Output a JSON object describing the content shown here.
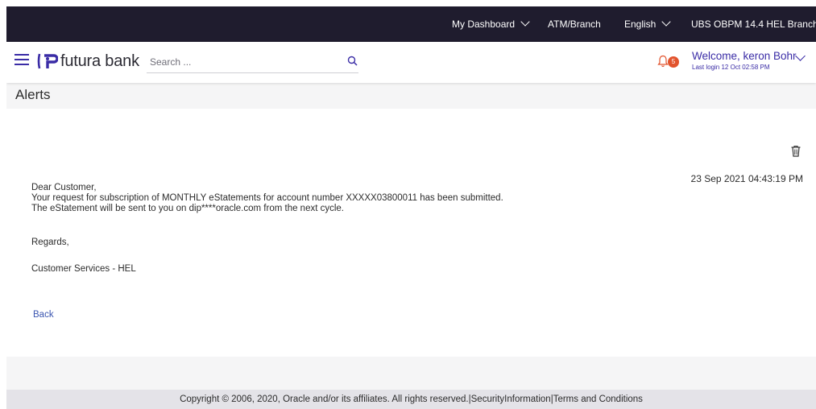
{
  "topbar": {
    "dashboard_label": "My Dashboard",
    "atm_branch_label": "ATM/Branch",
    "language_label": "English",
    "branch_label": "UBS OBPM 14.4 HEL Branch"
  },
  "header": {
    "logo_text": "futura bank",
    "search_placeholder": "Search ...",
    "notification_count": "5",
    "welcome_text": "Welcome, keron Bohr",
    "last_login": "Last login 12 Oct 02:58 PM"
  },
  "page": {
    "title": "Alerts"
  },
  "alert": {
    "datetime": "23 Sep 2021 04:43:19 PM",
    "greeting": "Dear Customer,",
    "line1": "Your request for subscription of MONTHLY eStatements for account number XXXXX03800011 has been submitted.",
    "line2": "The eStatement will be sent to you on dip****oracle.com from the next cycle.",
    "regards": "Regards,",
    "signature": "Customer Services - HEL",
    "back_label": "Back"
  },
  "footer": {
    "copyright": "Copyright © 2006, 2020, Oracle and/or its affiliates. All rights reserved.",
    "sep": "|",
    "security_link": "SecurityInformation",
    "terms_link": "Terms and Conditions"
  },
  "colors": {
    "topbar_bg": "#1f1c2e",
    "brand": "#3a2ca6",
    "badge": "#e2532d",
    "link": "#3a55b0"
  },
  "icons": [
    "hamburger-icon",
    "futura-logo-icon",
    "search-icon",
    "bell-icon",
    "trash-icon",
    "chevron-down-icon"
  ]
}
